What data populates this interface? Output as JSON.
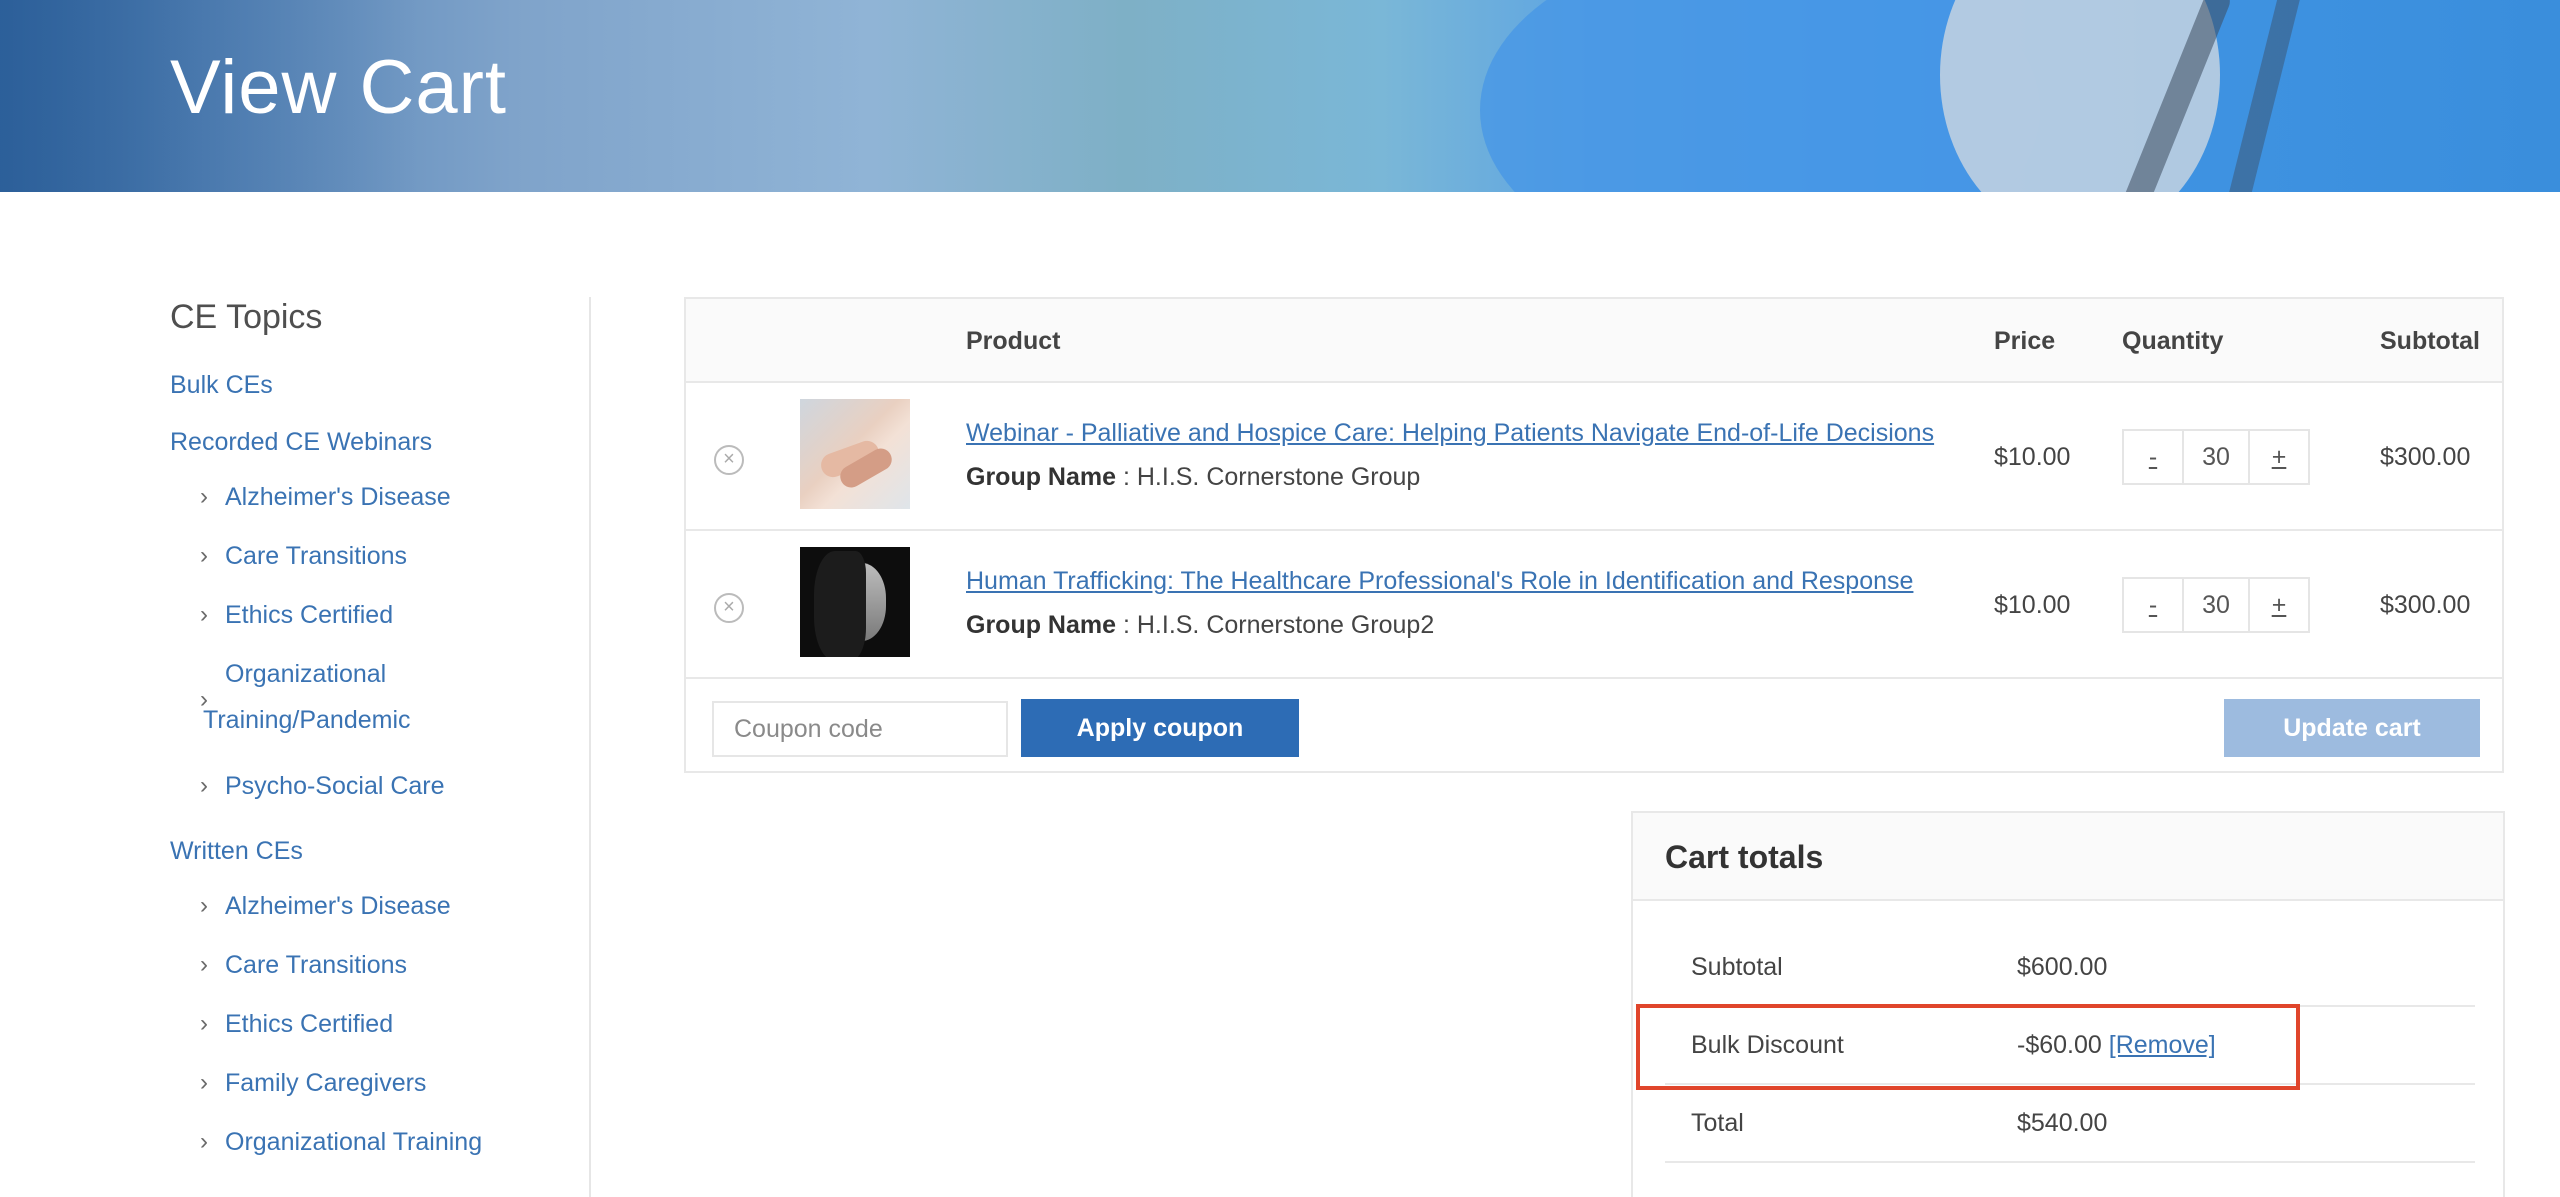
{
  "hero": {
    "title": "View Cart"
  },
  "sidebar": {
    "heading": "CE Topics",
    "categories": [
      {
        "label": "Bulk CEs",
        "items": []
      },
      {
        "label": "Recorded CE Webinars",
        "items": [
          "Alzheimer's Disease",
          "Care Transitions",
          "Ethics Certified",
          "Organizational",
          "Training/Pandemic",
          "Psycho-Social Care"
        ]
      },
      {
        "label": "Written CEs",
        "items": [
          "Alzheimer's Disease",
          "Care Transitions",
          "Ethics Certified",
          "Family Caregivers",
          "Organizational Training"
        ]
      }
    ]
  },
  "cart": {
    "headers": {
      "product": "Product",
      "price": "Price",
      "quantity": "Quantity",
      "subtotal": "Subtotal"
    },
    "rows": [
      {
        "title": "Webinar - Palliative and Hospice Care: Helping Patients Navigate End-of-Life Decisions",
        "group_label": "Group Name",
        "group_value": " : H.I.S. Cornerstone Group",
        "price": "$10.00",
        "qty": "30",
        "subtotal": "$300.00"
      },
      {
        "title": "Human Trafficking: The Healthcare Professional's Role in Identification and Response",
        "group_label": "Group Name",
        "group_value": " : H.I.S. Cornerstone Group2",
        "price": "$10.00",
        "qty": "30",
        "subtotal": "$300.00"
      }
    ],
    "qty_minus": "-",
    "qty_plus": "+",
    "remove_glyph": "×",
    "coupon_placeholder": "Coupon code",
    "apply_label": "Apply coupon",
    "update_label": "Update cart"
  },
  "totals": {
    "heading": "Cart totals",
    "subtotal_label": "Subtotal",
    "subtotal_value": "$600.00",
    "discount_label": "Bulk Discount",
    "discount_value": "-$60.00",
    "discount_remove": "[Remove]",
    "total_label": "Total",
    "total_value": "$540.00"
  },
  "colors": {
    "link": "#3a73b3",
    "primary_button": "#2d6cb5",
    "disabled_button": "#9dbbdf",
    "highlight": "#e0452b"
  }
}
